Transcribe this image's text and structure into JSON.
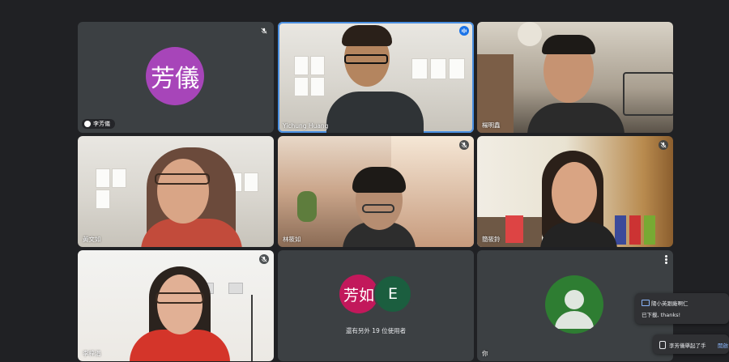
{
  "participants": [
    {
      "id": "p1",
      "name": "李芳儀",
      "avatar_text": "芳儀",
      "avatar_color": "#a745b9",
      "muted": true
    },
    {
      "id": "p2",
      "name": "Yichung Huang",
      "speaking": true
    },
    {
      "id": "p3",
      "name": "楊明鑫"
    },
    {
      "id": "p4",
      "name": "黃文如"
    },
    {
      "id": "p5",
      "name": "林筱如",
      "muted": true
    },
    {
      "id": "p6",
      "name": "簡筱鈴",
      "muted": true
    },
    {
      "id": "p7",
      "name": "李梓涓",
      "muted": true
    },
    {
      "id": "p8",
      "avatar_a": "芳如",
      "avatar_a_color": "#c2185b",
      "avatar_b": "E",
      "avatar_b_color": "#1b5e3f",
      "others_text": "還有另外 19 位使用者"
    },
    {
      "id": "p9",
      "name": "你",
      "avatar_color": "#2e7d32"
    }
  ],
  "chat_toast": {
    "sender": "陽小英跟廠啊仁",
    "message": "已下載, thanks!"
  },
  "hand_toast": {
    "text": "李芳儀舉起了手",
    "action": "開啟"
  },
  "colors": {
    "background": "#202124",
    "tile": "#3c4043",
    "speaking": "#1a73e8"
  }
}
